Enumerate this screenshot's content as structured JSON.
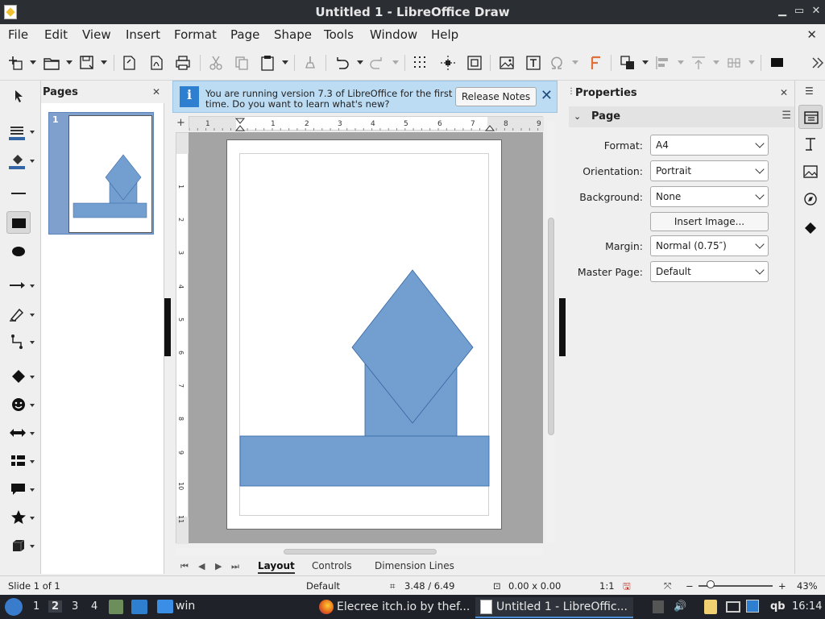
{
  "window": {
    "title": "Untitled 1 - LibreOffice Draw"
  },
  "menu": {
    "items": [
      "File",
      "Edit",
      "View",
      "Insert",
      "Format",
      "Page",
      "Shape",
      "Tools",
      "Window",
      "Help"
    ]
  },
  "pages_panel": {
    "title": "Pages",
    "thumb_number": "1"
  },
  "infobar": {
    "message": "You are running version 7.3 of LibreOffice for the first time. Do you want to learn what's new?",
    "button_label": "Release Notes"
  },
  "ruler": {
    "h_ticks": [
      "1",
      "1",
      "2",
      "3",
      "4",
      "5",
      "6",
      "7",
      "8",
      "9"
    ],
    "v_ticks": [
      "1",
      "2",
      "3",
      "4",
      "5",
      "6",
      "7",
      "8",
      "9",
      "10",
      "11"
    ]
  },
  "tabs": [
    "Layout",
    "Controls",
    "Dimension Lines"
  ],
  "properties": {
    "title": "Properties",
    "section": "Page",
    "format_label": "Format:",
    "format_value": "A4",
    "orientation_label": "Orientation:",
    "orientation_value": "Portrait",
    "background_label": "Background:",
    "background_value": "None",
    "insert_image_label": "Insert Image...",
    "margin_label": "Margin:",
    "margin_value": "Normal (0.75″)",
    "master_label": "Master Page:",
    "master_value": "Default"
  },
  "status": {
    "slide": "Slide 1 of 1",
    "layout": "Default",
    "position": "3.48 / 6.49",
    "size": "0.00 x 0.00",
    "scale": "1:1",
    "zoom": "43%"
  },
  "taskbar": {
    "workspaces": [
      "1",
      "2",
      "3",
      "4"
    ],
    "folder_label": "win",
    "firefox_label": "Elecree itch.io by thef...",
    "libre_label": "Untitled 1 - LibreOffic...",
    "tray_text": "qb",
    "clock": "16:14"
  },
  "colors": {
    "shape_fill": "#729fcf",
    "shape_stroke": "#3465a4",
    "accent": "#4d8fd6"
  }
}
